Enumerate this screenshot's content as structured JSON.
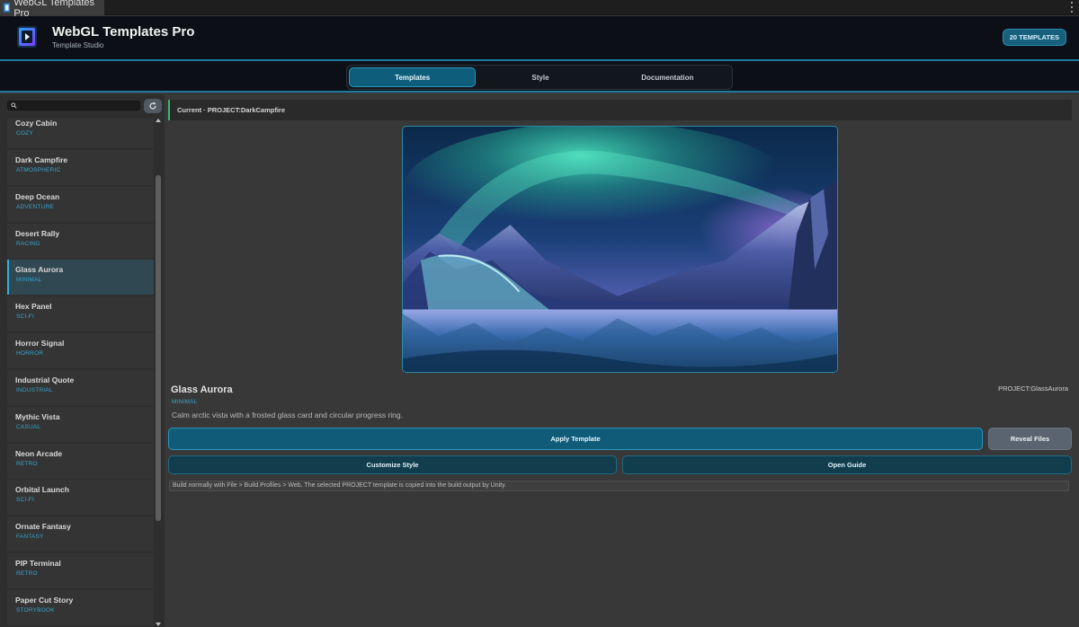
{
  "window": {
    "tab_title": "WebGL Templates Pro"
  },
  "header": {
    "title": "WebGL Templates Pro",
    "subtitle": "Template Studio",
    "badge": "20 TEMPLATES"
  },
  "nav": {
    "tabs": [
      {
        "label": "Templates",
        "active": true
      },
      {
        "label": "Style",
        "active": false
      },
      {
        "label": "Documentation",
        "active": false
      }
    ]
  },
  "sidebar": {
    "search": {
      "value": "",
      "placeholder": ""
    },
    "items": [
      {
        "name": "Cozy Cabin",
        "category": "COZY"
      },
      {
        "name": "Dark Campfire",
        "category": "ATMOSPHERIC"
      },
      {
        "name": "Deep Ocean",
        "category": "ADVENTURE"
      },
      {
        "name": "Desert Rally",
        "category": "RACING"
      },
      {
        "name": "Glass Aurora",
        "category": "MINIMAL",
        "selected": true
      },
      {
        "name": "Hex Panel",
        "category": "SCI-FI"
      },
      {
        "name": "Horror Signal",
        "category": "HORROR"
      },
      {
        "name": "Industrial Quote",
        "category": "INDUSTRIAL"
      },
      {
        "name": "Mythic Vista",
        "category": "CASUAL"
      },
      {
        "name": "Neon Arcade",
        "category": "RETRO"
      },
      {
        "name": "Orbital Launch",
        "category": "SCI-FI"
      },
      {
        "name": "Ornate Fantasy",
        "category": "FANTASY"
      },
      {
        "name": "PIP Terminal",
        "category": "RETRO"
      },
      {
        "name": "Paper Cut Story",
        "category": "STORYBOOK"
      }
    ]
  },
  "main": {
    "current": "Current · PROJECT:DarkCampfire",
    "template": {
      "name": "Glass Aurora",
      "category": "MINIMAL",
      "id": "PROJECT:GlassAurora",
      "description": "Calm arctic vista with a frosted glass card and circular progress ring."
    },
    "buttons": {
      "apply": "Apply Template",
      "reveal": "Reveal Files",
      "customize": "Customize Style",
      "guide": "Open Guide"
    },
    "hint": "Build normally with File > Build Profiles > Web. The selected PROJECT template is copied into the build output by Unity."
  },
  "colors": {
    "accent": "#1f7aa0",
    "category_text": "#36a6cf",
    "current_marker": "#2fbf6a",
    "selected_marker": "#2fb0e0"
  }
}
